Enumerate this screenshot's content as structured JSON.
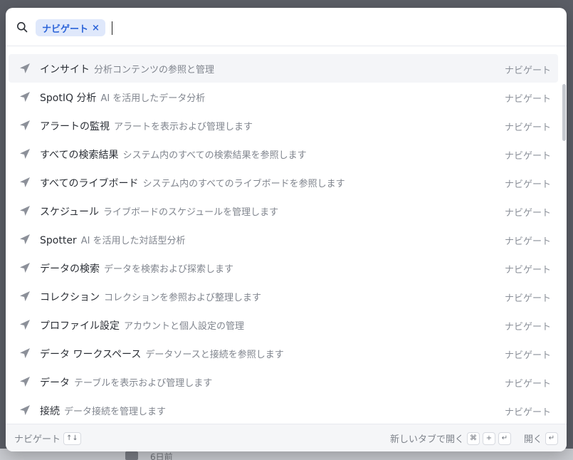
{
  "background": {
    "date_text": "6日前"
  },
  "search": {
    "chip_label": "ナビゲート",
    "chip_close": "×",
    "placeholder": "",
    "value": ""
  },
  "results": [
    {
      "title": "インサイト",
      "description": "分析コンテンツの参照と管理",
      "tag": "ナビゲート",
      "active": true
    },
    {
      "title": "SpotIQ 分析",
      "description": "AI を活用したデータ分析",
      "tag": "ナビゲート",
      "active": false
    },
    {
      "title": "アラートの監視",
      "description": "アラートを表示および管理します",
      "tag": "ナビゲート",
      "active": false
    },
    {
      "title": "すべての検索結果",
      "description": "システム内のすべての検索結果を参照します",
      "tag": "ナビゲート",
      "active": false
    },
    {
      "title": "すべてのライブボード",
      "description": "システム内のすべてのライブボードを参照します",
      "tag": "ナビゲート",
      "active": false
    },
    {
      "title": "スケジュール",
      "description": "ライブボードのスケジュールを管理します",
      "tag": "ナビゲート",
      "active": false
    },
    {
      "title": "Spotter",
      "description": "AI を活用した対話型分析",
      "tag": "ナビゲート",
      "active": false
    },
    {
      "title": "データの検索",
      "description": "データを検索および探索します",
      "tag": "ナビゲート",
      "active": false
    },
    {
      "title": "コレクション",
      "description": "コレクションを参照および整理します",
      "tag": "ナビゲート",
      "active": false
    },
    {
      "title": "プロファイル設定",
      "description": "アカウントと個人設定の管理",
      "tag": "ナビゲート",
      "active": false
    },
    {
      "title": "データ ワークスペース",
      "description": "データソースと接続を参照します",
      "tag": "ナビゲート",
      "active": false
    },
    {
      "title": "データ",
      "description": "テーブルを表示および管理します",
      "tag": "ナビゲート",
      "active": false
    },
    {
      "title": "接続",
      "description": "データ接続を管理します",
      "tag": "ナビゲート",
      "active": false
    }
  ],
  "footer": {
    "navigate_label": "ナビゲート",
    "navigate_key": "↑↓",
    "new_tab_label": "新しいタブで開く",
    "new_tab_keys": [
      "⌘",
      "+",
      "↵"
    ],
    "open_label": "開く",
    "open_key": "↵"
  },
  "icons": {
    "search": "search-icon",
    "row": "send-icon"
  }
}
